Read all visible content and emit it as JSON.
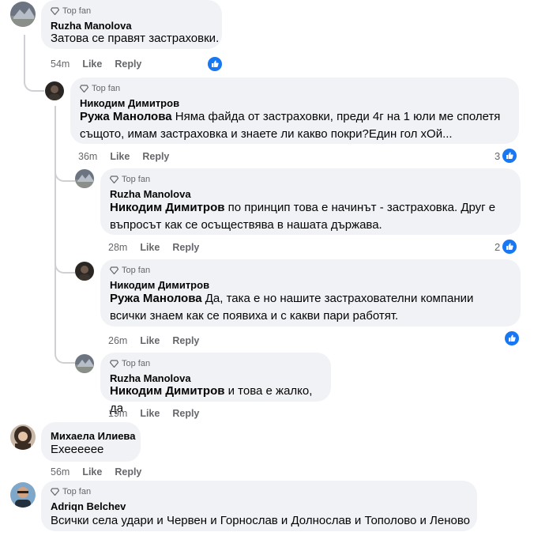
{
  "badges": {
    "top_fan": "Top fan"
  },
  "actions": {
    "like": "Like",
    "reply": "Reply"
  },
  "comments": [
    {
      "author": "Ruzha Manolova",
      "text": "Затова се правят застраховки.",
      "time": "54m",
      "reactions": ""
    },
    {
      "author": "Никодим Димитров",
      "mention": "Ружа Манолова",
      "text": " Няма файда от застраховки, преди 4г на 1 юли ме сполетя същото, имам застраховка и знаете ли какво покри?Един гол хОй...",
      "time": "36m",
      "reactions": "3"
    },
    {
      "author": "Ruzha Manolova",
      "mention": "Никодим Димитров",
      "text": " по принцип това е начинът - застраховка. Друг е въпросът как се осъществява в нашата държава.",
      "time": "28m",
      "reactions": "2"
    },
    {
      "author": "Никодим Димитров",
      "mention": "Ружа Манолова",
      "text": " Да, така е но нашите застрахователни компании всички знаем как се появиха и с какви пари работят.",
      "time": "26m",
      "reactions": ""
    },
    {
      "author": "Ruzha Manolova",
      "mention": "Никодим Димитров",
      "text": " и това е жалко, да",
      "time": "19m",
      "reactions": ""
    },
    {
      "author": "Михаела Илиева",
      "text": "Ехеееeee",
      "time": "56m",
      "reactions": ""
    },
    {
      "author": "Adriqn Belchev",
      "text": "Всички села удари и Червен и Горнослав и Долнослав и Тополово и Леново",
      "time": "",
      "reactions": ""
    }
  ],
  "colors": {
    "bubble": "#f0f2f5",
    "meta": "#65676b",
    "accent": "#1877f2"
  }
}
